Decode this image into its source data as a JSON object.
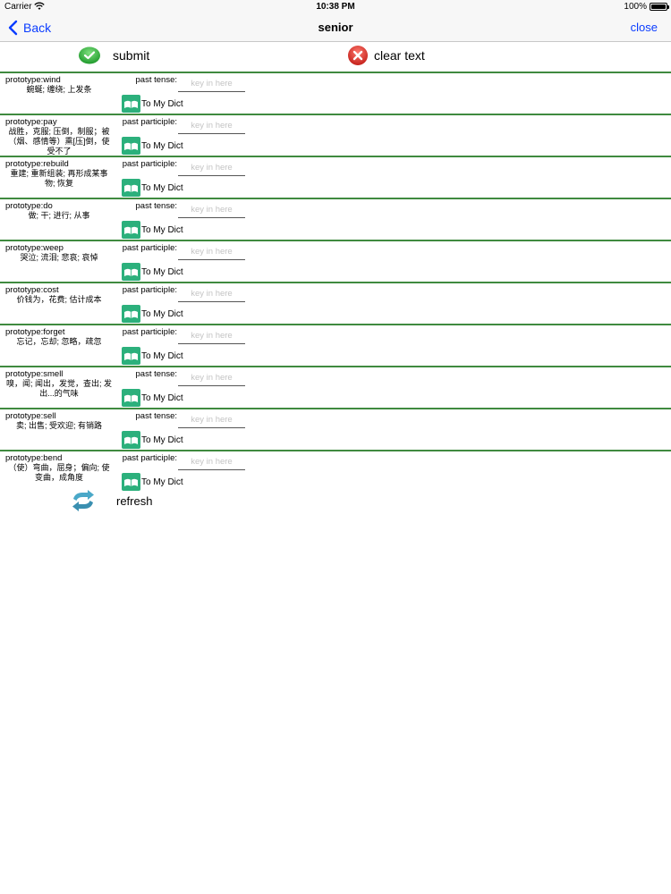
{
  "status_bar": {
    "carrier": "Carrier",
    "time": "10:38 PM",
    "battery": "100%",
    "battery_level": 1.0
  },
  "nav": {
    "back_label": "Back",
    "title": "senior",
    "close_label": "close",
    "link_color": "#0a3cff"
  },
  "actions": {
    "submit_label": "submit",
    "clear_label": "clear text"
  },
  "entries": [
    {
      "prototype": "prototype:wind",
      "meaning": "蜿蜒; 缠绕; 上发条",
      "form_label": "past tense:",
      "placeholder": "key in here",
      "value": "",
      "dict_label": "To My Dict"
    },
    {
      "prototype": "prototype:pay",
      "meaning": "战胜，克服; 压倒，制服；被（烟、感情等）熏[压]倒，使受不了",
      "form_label": "past participle:",
      "placeholder": "key in here",
      "value": "",
      "dict_label": "To My Dict"
    },
    {
      "prototype": "prototype:rebuild",
      "meaning": "重建; 重新组装; 再形成某事物; 恢复",
      "form_label": "past participle:",
      "placeholder": "key in here",
      "value": "",
      "dict_label": "To My Dict"
    },
    {
      "prototype": "prototype:do",
      "meaning": "做; 干; 进行; 从事",
      "form_label": "past tense:",
      "placeholder": "key in here",
      "value": "",
      "dict_label": "To My Dict"
    },
    {
      "prototype": "prototype:weep",
      "meaning": "哭泣; 流泪; 悲哀; 哀悼",
      "form_label": "past participle:",
      "placeholder": "key in here",
      "value": "",
      "dict_label": "To My Dict"
    },
    {
      "prototype": "prototype:cost",
      "meaning": "价钱为，花费; 估计成本",
      "form_label": "past participle:",
      "placeholder": "key in here",
      "value": "",
      "dict_label": "To My Dict"
    },
    {
      "prototype": "prototype:forget",
      "meaning": "忘记，忘却; 忽略，疏忽",
      "form_label": "past participle:",
      "placeholder": "key in here",
      "value": "",
      "dict_label": "To My Dict"
    },
    {
      "prototype": "prototype:smell",
      "meaning": "嗅，闻; 闻出，发觉，查出; 发出...的气味",
      "form_label": "past tense:",
      "placeholder": "key in here",
      "value": "",
      "dict_label": "To My Dict"
    },
    {
      "prototype": "prototype:sell",
      "meaning": "卖; 出售; 受欢迎; 有销路",
      "form_label": "past tense:",
      "placeholder": "key in here",
      "value": "",
      "dict_label": "To My Dict"
    },
    {
      "prototype": "prototype:bend",
      "meaning": "（使）弯曲，屈身；偏向; 使变曲，成角度",
      "form_label": "past participle:",
      "placeholder": "key in here",
      "value": "",
      "dict_label": "To My Dict"
    }
  ],
  "refresh_label": "refresh",
  "colors": {
    "divider": "#3f8a3f",
    "submit_green": "#2fae3a",
    "clear_red": "#d9302a",
    "book_teal": "#2cb07c"
  },
  "icons": {
    "back": "chevron-left-icon",
    "wifi": "wifi-icon",
    "battery": "battery-icon",
    "submit": "check-circle-icon",
    "clear": "x-circle-icon",
    "dict": "book-icon",
    "refresh": "refresh-arrows-icon"
  }
}
